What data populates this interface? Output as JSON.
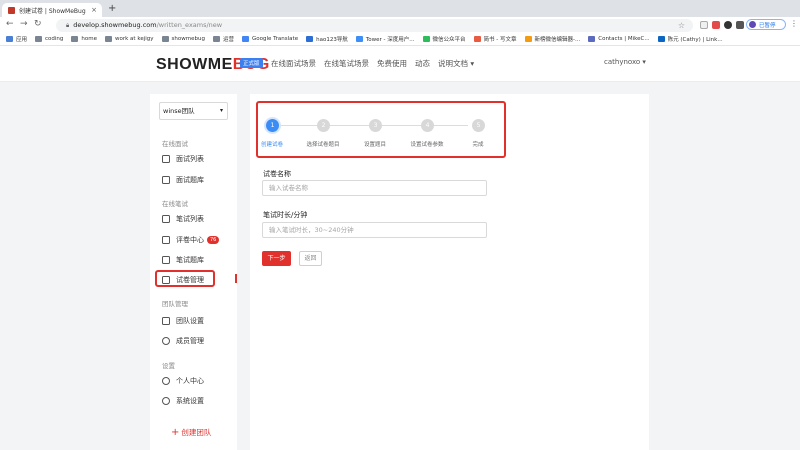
{
  "browser": {
    "tab_title": "创建试卷 | ShowMeBug",
    "tab_close": "×",
    "new_tab": "+",
    "url_host": "develop.showmebug.com",
    "url_path": "/written_exams/new",
    "profile_status": "已暂停",
    "bookmarks": [
      "应用",
      "coding",
      "home",
      "work at kejigy",
      "showmebug",
      "运营",
      "Google Translate",
      "hao123导航",
      "Tower - 深度用户...",
      "微信公众平台",
      "简书 - 写文章",
      "新榜微信编辑器-...",
      "Contacts | MikeC...",
      "陈元 (Cathy) | Link..."
    ]
  },
  "header": {
    "logo_main": "SHOWME",
    "logo_accent": "BUG",
    "edition": "正式版",
    "nav": [
      "在线面试场景",
      "在线笔试场景",
      "免费使用",
      "动态",
      "说明文档 ▾"
    ],
    "user": "cathynoxo ▾"
  },
  "sidebar": {
    "team": "winse团队",
    "sections": {
      "interview": "在线面试",
      "written": "在线笔试",
      "team": "团队管理",
      "settings": "设置"
    },
    "items": {
      "interview_list": "面试列表",
      "interview_bank": "面试题库",
      "written_list": "笔试列表",
      "review_center": "评卷中心",
      "review_badge": "76",
      "written_bank": "笔试题库",
      "paper_manage": "试卷管理",
      "team_settings": "团队设置",
      "members": "成员管理",
      "profile": "个人中心",
      "system": "系统设置"
    },
    "create_team": "创建团队"
  },
  "wizard": {
    "steps": [
      {
        "num": "1",
        "label": "创建试卷"
      },
      {
        "num": "2",
        "label": "选择试卷题目"
      },
      {
        "num": "3",
        "label": "设置题目"
      },
      {
        "num": "4",
        "label": "设置试卷参数"
      },
      {
        "num": "5",
        "label": "完成"
      }
    ],
    "active_step": 1
  },
  "form": {
    "name_label": "试卷名称",
    "name_placeholder": "输入试卷名称",
    "duration_label": "笔试时长/分钟",
    "duration_placeholder": "输入笔试时长，30~240分钟",
    "next": "下一步",
    "back": "返回"
  }
}
